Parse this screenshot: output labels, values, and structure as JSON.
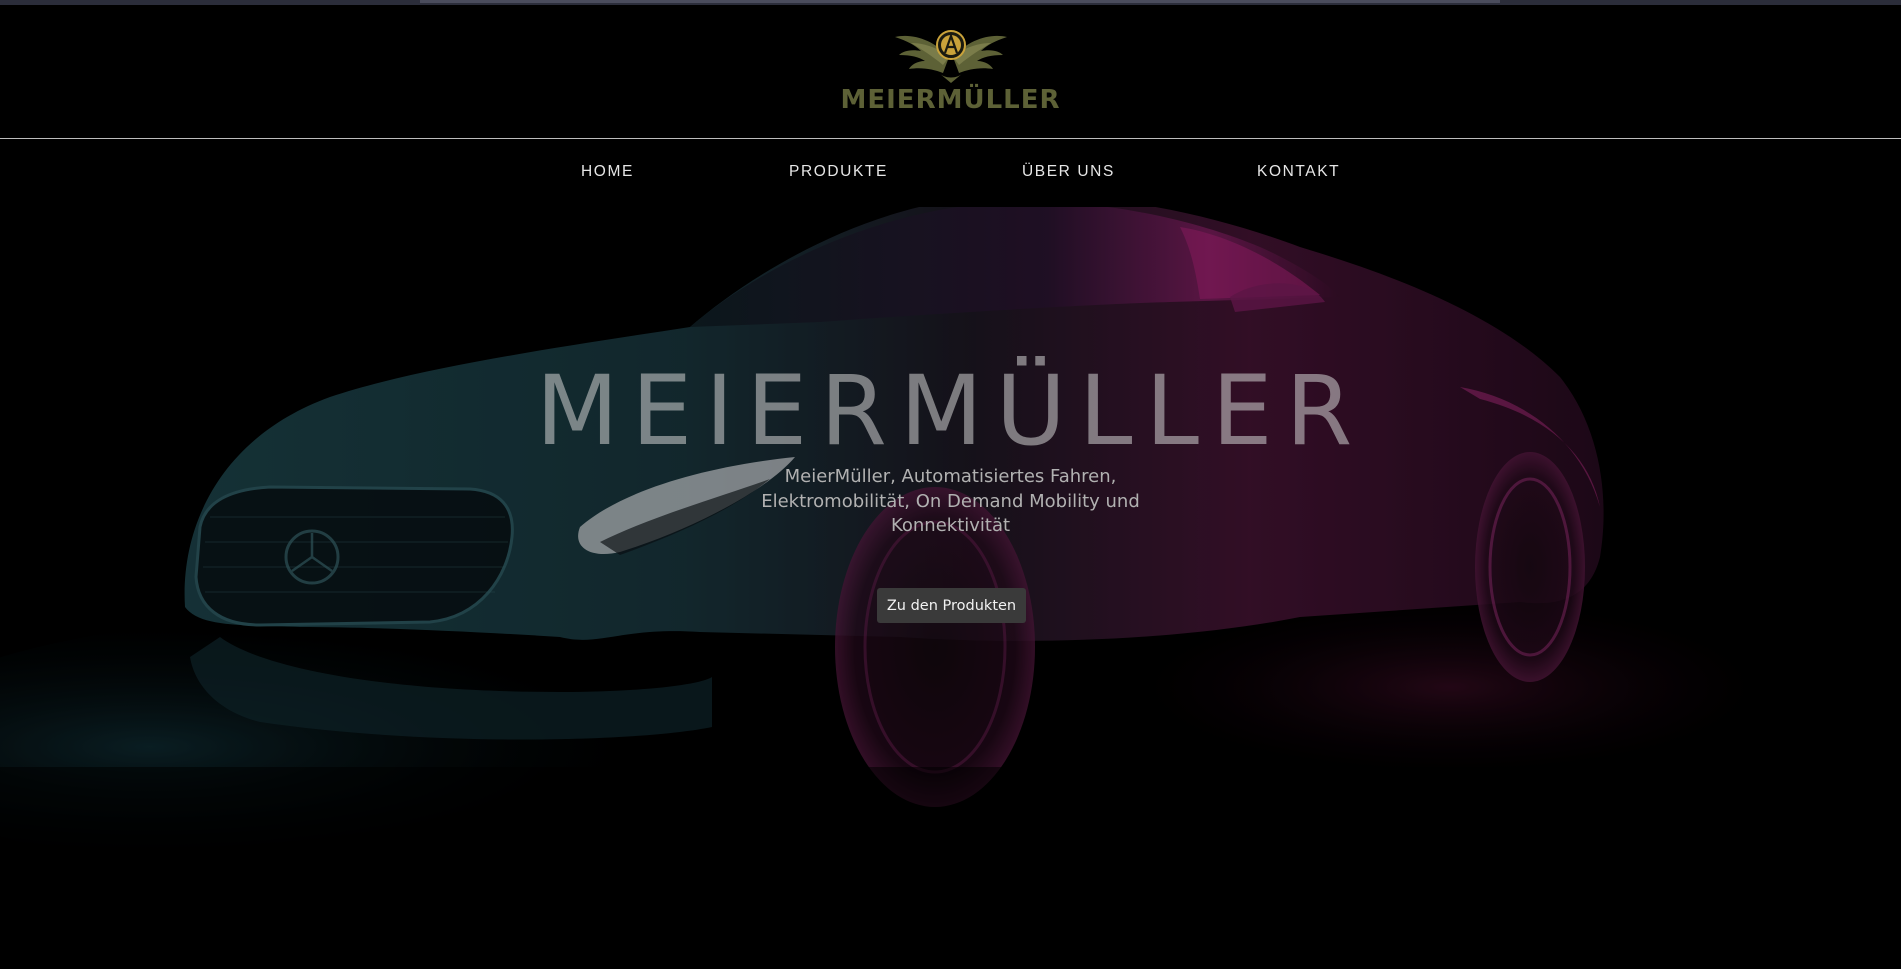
{
  "brand": {
    "logo_text": "MEIERMÜLLER",
    "logo_icon": "winged-a-emblem-icon",
    "logo_color": "#5d6136",
    "emblem_gold": "#c9a23a"
  },
  "nav": {
    "items": [
      {
        "label": "HOME"
      },
      {
        "label": "PRODUKTE"
      },
      {
        "label": "ÜBER UNS"
      },
      {
        "label": "KONTAKT"
      }
    ]
  },
  "hero": {
    "title": "MEIERMÜLLER",
    "subtitle": "MeierMüller, Automatisiertes Fahren, Elektromobilität, On Demand Mobility und Konnektivität",
    "cta_label": "Zu den Produkten",
    "background_icon": "sports-car-image",
    "accent_teal": "#4fa3b0",
    "accent_magenta": "#b0237a"
  }
}
